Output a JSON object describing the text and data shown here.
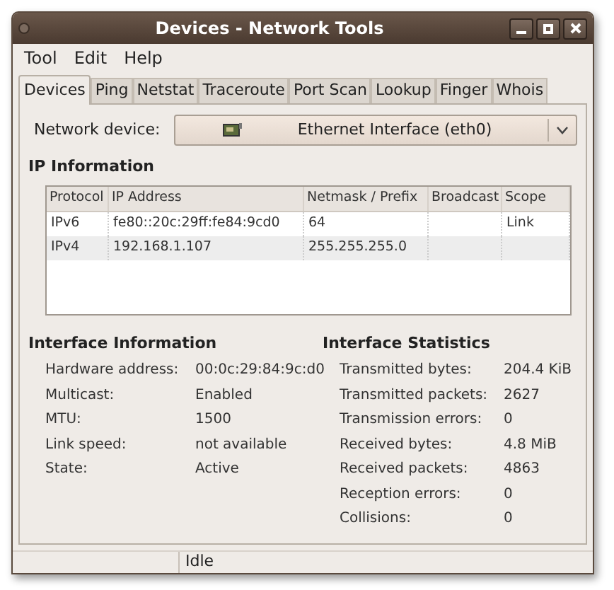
{
  "window": {
    "title": "Devices - Network Tools"
  },
  "menu": [
    "Tool",
    "Edit",
    "Help"
  ],
  "tabs": [
    {
      "label": "Devices",
      "selected": true
    },
    {
      "label": "Ping",
      "selected": false
    },
    {
      "label": "Netstat",
      "selected": false
    },
    {
      "label": "Traceroute",
      "selected": false
    },
    {
      "label": "Port Scan",
      "selected": false
    },
    {
      "label": "Lookup",
      "selected": false
    },
    {
      "label": "Finger",
      "selected": false
    },
    {
      "label": "Whois",
      "selected": false
    }
  ],
  "device": {
    "label": "Network device:",
    "value": "Ethernet Interface (eth0)"
  },
  "ip_information": {
    "title": "IP Information",
    "columns": [
      "Protocol",
      "IP Address",
      "Netmask / Prefix",
      "Broadcast",
      "Scope"
    ],
    "rows": [
      [
        "IPv6",
        "fe80::20c:29ff:fe84:9cd0",
        "64",
        "",
        "Link"
      ],
      [
        "IPv4",
        "192.168.1.107",
        "255.255.255.0",
        "",
        ""
      ]
    ]
  },
  "interface_information": {
    "title": "Interface Information",
    "fields": [
      {
        "label": "Hardware address:",
        "value": "00:0c:29:84:9c:d0"
      },
      {
        "label": "Multicast:",
        "value": "Enabled"
      },
      {
        "label": "MTU:",
        "value": "1500"
      },
      {
        "label": "Link speed:",
        "value": "not available"
      },
      {
        "label": "State:",
        "value": "Active"
      }
    ]
  },
  "interface_statistics": {
    "title": "Interface Statistics",
    "fields": [
      {
        "label": "Transmitted bytes:",
        "value": "204.4 KiB"
      },
      {
        "label": "Transmitted packets:",
        "value": "2627"
      },
      {
        "label": "Transmission errors:",
        "value": "0"
      },
      {
        "label": "Received bytes:",
        "value": "4.8 MiB"
      },
      {
        "label": "Received packets:",
        "value": "4863"
      },
      {
        "label": "Reception errors:",
        "value": "0"
      },
      {
        "label": "Collisions:",
        "value": "0"
      }
    ]
  },
  "status_bar": {
    "text": "Idle"
  }
}
